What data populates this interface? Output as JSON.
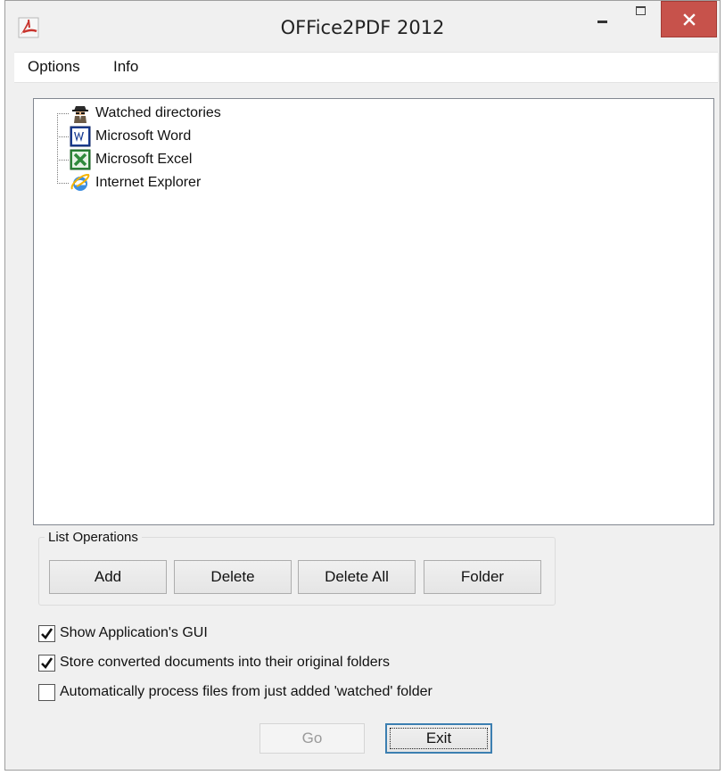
{
  "window": {
    "title": "OFFice2PDF 2012",
    "app_icon": "pdf-app-icon",
    "controls": {
      "minimize": "minimize-icon",
      "maximize": "maximize-icon",
      "close": "close-icon"
    },
    "accent_close_color": "#c7524b"
  },
  "menu": {
    "options_label": "Options",
    "info_label": "Info"
  },
  "tree": {
    "items": [
      {
        "label": "Watched directories",
        "icon": "spy-agent-icon"
      },
      {
        "label": "Microsoft Word",
        "icon": "word-icon"
      },
      {
        "label": "Microsoft Excel",
        "icon": "excel-icon"
      },
      {
        "label": "Internet Explorer",
        "icon": "internet-explorer-icon"
      }
    ]
  },
  "list_operations": {
    "legend": "List Operations",
    "add_label": "Add",
    "delete_label": "Delete",
    "delete_all_label": "Delete All",
    "folder_label": "Folder"
  },
  "options": {
    "show_gui": {
      "label": "Show Application's GUI",
      "checked": true
    },
    "store_original": {
      "label": "Store converted documents into their original folders",
      "checked": true
    },
    "auto_process": {
      "label": "Automatically process files from just added 'watched' folder",
      "checked": false
    }
  },
  "footer": {
    "go_label": "Go",
    "go_enabled": false,
    "exit_label": "Exit"
  }
}
